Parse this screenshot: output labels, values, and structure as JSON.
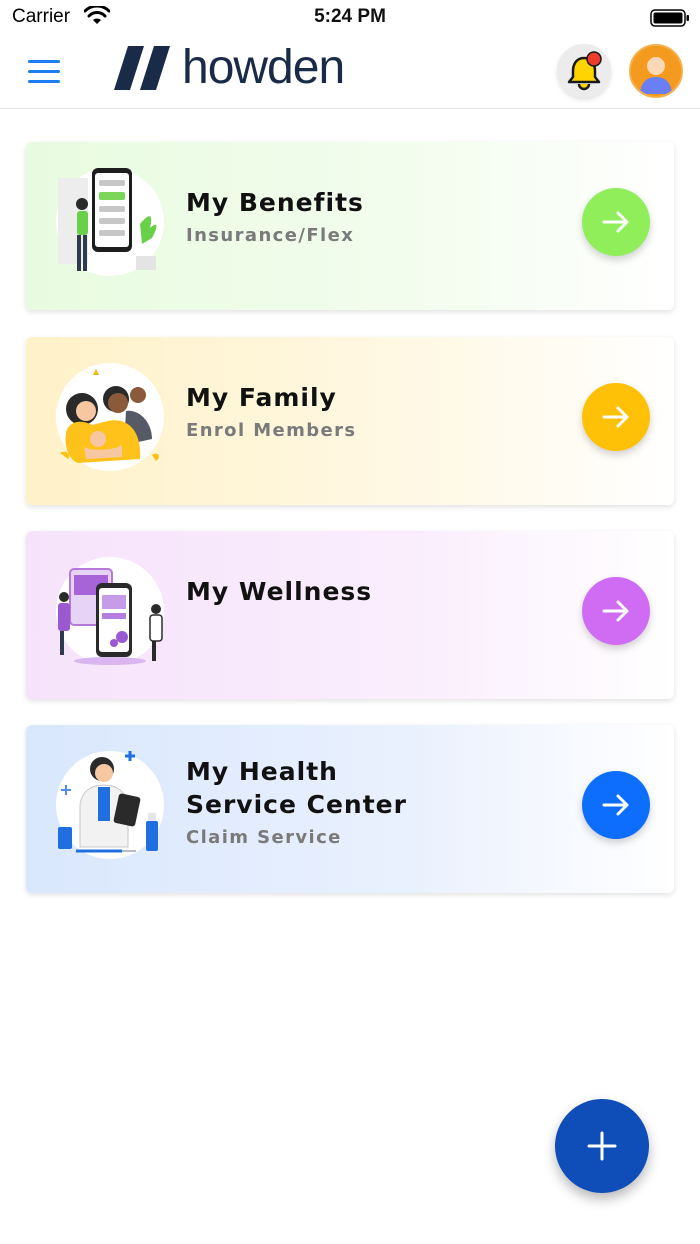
{
  "status_bar": {
    "carrier": "Carrier",
    "time": "5:24 PM"
  },
  "header": {
    "logo_text": "howden",
    "brand_color": "#1a2b48",
    "accent_color": "#1c7ef0",
    "icons": [
      "menu-icon",
      "bell-icon",
      "avatar-icon"
    ]
  },
  "cards": [
    {
      "title_line1": "My Benefits",
      "subtitle": "Insurance/Flex",
      "accent": "#8fee5a",
      "icon": "arrow-right-icon"
    },
    {
      "title_line1": "My Family",
      "subtitle": "Enrol Members",
      "accent": "#ffc107",
      "icon": "arrow-right-icon"
    },
    {
      "title_line1": "My Wellness",
      "subtitle": "",
      "accent": "#cf6cf3",
      "icon": "arrow-right-icon"
    },
    {
      "title_line1": "My Health",
      "title_line2": "Service Center",
      "subtitle": "Claim Service",
      "accent": "#0d6efd",
      "icon": "arrow-right-icon"
    }
  ],
  "fab": {
    "icon": "plus-icon",
    "color": "#0f4db8"
  }
}
